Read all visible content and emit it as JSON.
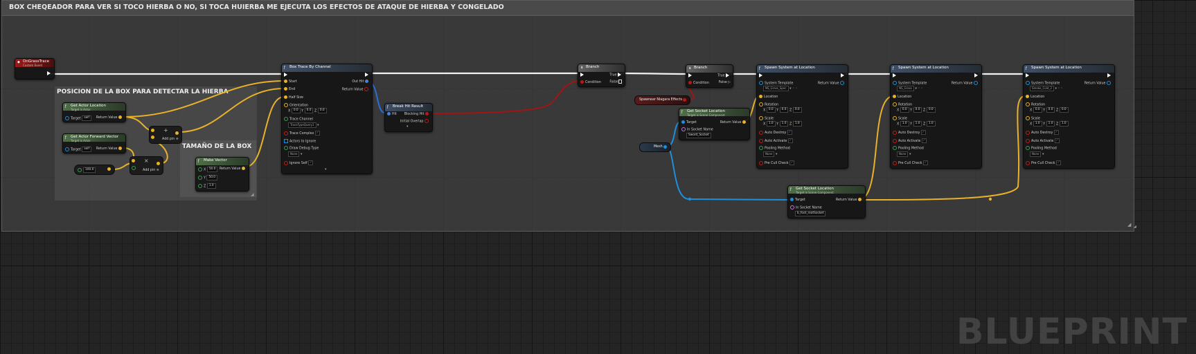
{
  "comment_main": {
    "title": "BOX CHEQEADOR PARA VER SI TOCO HIERBA O NO, SI TOCA HUIERBA ME EJECUTA LOS EFECTOS DE ATAQUE DE HIERBA Y CONGELADO"
  },
  "comment_box": {
    "title": "POSICION DE LA BOX PARA DETECTAR LA HIERBA"
  },
  "comment_size": {
    "title": "TAMAÑO DE LA BOX"
  },
  "event": {
    "title": "OnGrassTrace",
    "subtitle": "Custom Event"
  },
  "actor_location": {
    "title": "Get Actor Location",
    "subtitle": "Target is Actor",
    "target": "Target",
    "target_value": "self",
    "return": "Return Value"
  },
  "forward_vector": {
    "title": "Get Actor Forward Vector",
    "subtitle": "Target is Actor",
    "target": "Target",
    "target_value": "self",
    "return": "Return Value"
  },
  "float_const": {
    "value": "100.0"
  },
  "add1": {
    "symbol": "+",
    "label": "Add pin"
  },
  "add2": {
    "symbol": "×",
    "label": "Add pin"
  },
  "make_vector": {
    "title": "Make Vector",
    "x_label": "X",
    "x_value": "50.0",
    "y_label": "Y",
    "y_value": "50.0",
    "z_label": "Z",
    "z_value": "1.0",
    "return": "Return Value"
  },
  "box_trace": {
    "title": "Box Trace By Channel",
    "start": "Start",
    "end": "End",
    "half_size": "Half Size",
    "orientation": "Orientation",
    "orient_vals": [
      "0.0",
      "0.0",
      "0.0"
    ],
    "trace_channel": "Trace Channel",
    "trace_channel_value": "TraceTypeQuery1",
    "trace_complex": "Trace Complex",
    "actors_to_ignore": "Actors to Ignore",
    "draw_debug": "Draw Debug Type",
    "draw_debug_value": "None",
    "ignore_self": "Ignore Self",
    "out_hit": "Out Hit",
    "return": "Return Value"
  },
  "break_hit": {
    "title": "Break Hit Result",
    "hit": "Hit",
    "blocking_hit": "Blocking Hit",
    "initial_overlap": "Initial Overlap"
  },
  "branch1": {
    "title": "Branch",
    "condition": "Condition",
    "true_label": "True",
    "false_label": "False"
  },
  "branch2": {
    "title": "Branch",
    "condition": "Condition",
    "true_label": "True",
    "false_label": "False"
  },
  "niagara_var": {
    "label": "Spawnear Niagara Effects"
  },
  "mesh_var": {
    "label": "Mesh"
  },
  "socket1": {
    "title": "Get Socket Location",
    "subtitle": "Target is Scene Component",
    "target": "Target",
    "socket_label": "In Socket Name",
    "socket_value": "Sword_Socket",
    "return": "Return Value"
  },
  "socket2": {
    "title": "Get Socket Location",
    "subtitle": "Target is Scene Component",
    "target": "Target",
    "socket_label": "In Socket Name",
    "socket_value": "b_foot_rootSocket",
    "return": "Return Value"
  },
  "spawn_nodes": [
    {
      "title": "Spawn System at Location",
      "template_label": "System Template",
      "template_value": "NS_Grass_Spec",
      "location": "Location",
      "rotation": "Rotation",
      "rot_vals": [
        "0.0",
        "0.0",
        "0.0"
      ],
      "scale": "Scale",
      "scale_vals": [
        "1.0",
        "1.0",
        "1.0"
      ],
      "auto_destroy": "Auto Destroy",
      "auto_activate": "Auto Activate",
      "pooling": "Pooling Method",
      "pooling_value": "None",
      "pre_cull": "Pre Cull Check",
      "return": "Return Value"
    },
    {
      "title": "Spawn System at Location",
      "template_label": "System Template",
      "template_value": "NS_Grass",
      "location": "Location",
      "rotation": "Rotation",
      "rot_vals": [
        "0.0",
        "0.0",
        "0.0"
      ],
      "scale": "Scale",
      "scale_vals": [
        "1.0",
        "1.0",
        "1.0"
      ],
      "auto_destroy": "Auto Destroy",
      "auto_activate": "Auto Activate",
      "pooling": "Pooling Method",
      "pooling_value": "None",
      "pre_cull": "Pre Cull Check",
      "return": "Return Value"
    },
    {
      "title": "Spawn System at Location",
      "template_label": "System Template",
      "template_value": "Smoke_Cold_2",
      "location": "Location",
      "rotation": "Rotation",
      "rot_vals": [
        "0.0",
        "0.0",
        "0.0"
      ],
      "scale": "Scale",
      "scale_vals": [
        "1.0",
        "1.0",
        "1.0"
      ],
      "auto_destroy": "Auto Destroy",
      "auto_activate": "Auto Activate",
      "pooling": "Pooling Method",
      "pooling_value": "None",
      "pre_cull": "Pre Cull Check",
      "return": "Return Value"
    }
  ],
  "watermark": "BLUEPRINT",
  "colors": {
    "exec": "#ffffff",
    "vector": "#e8b22a",
    "object": "#1e8fdc",
    "bool": "#b81818",
    "struct": "#1a6fd6"
  }
}
